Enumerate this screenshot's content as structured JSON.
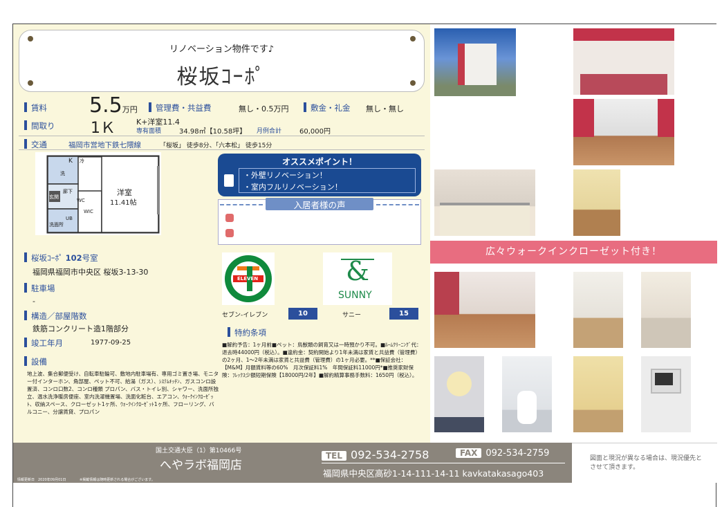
{
  "header": {
    "subtitle": "リノベーション物件です♪",
    "title": "桜坂ｺｰﾎﾟ"
  },
  "rent": {
    "label": "賃料",
    "amount": "5.5",
    "unit": "万円",
    "fee_label": "管理費・共益費",
    "fee_value": "無し・0.5万円",
    "deposit_label": "敷金・礼金",
    "deposit_value": "無し・無し"
  },
  "layout": {
    "label": "間取り",
    "value": "1Ｋ",
    "detail": "K+洋室11.4",
    "area_label": "専有面積",
    "area_value": "34.98㎡【10.58坪】",
    "monthly_label": "月例合計",
    "monthly_value": "60,000円"
  },
  "transport": {
    "label": "交通",
    "line": "福岡市営地下鉄七隈線",
    "stations": "「桜坂」 徒歩8分、「六本松」 徒歩15分"
  },
  "floorplan": {
    "room_name": "洋室",
    "room_size": "11.41帖",
    "k": "K",
    "ro": "冷",
    "wc": "WC",
    "ub": "UB",
    "genkan": "玄関",
    "rouka": "廊下",
    "sen": "洗",
    "senmen": "洗面所",
    "wic": "WIC"
  },
  "points": {
    "title": "オススメポイント！",
    "items": [
      "・外壁リノベーション！",
      "・室内フルリノベーション！"
    ]
  },
  "voice": {
    "title": "入居者様の声"
  },
  "property": {
    "name_prefix": "桜坂ｺｰﾎﾟ",
    "room": "102",
    "room_suffix": "号室",
    "address": "福岡県福岡市中央区 桜坂3-13-30",
    "parking_label": "駐車場",
    "parking_value": "-",
    "structure_label": "構造／部屋階数",
    "structure_value": "鉄筋コンクリート造1階部分",
    "built_label": "竣工年月",
    "built_value": "1977-09-25",
    "equip_label": "設備",
    "equip_value": "地上波、集合郵便受け、自転車駐輪可、敷地内駐車場有、専用ゴミ置き場、モニター付インターホン、角部屋、ペット不可、給湯（ガス）、ｼｽﾃﾑｷｯﾁﾝ、ガスコンロ設置済、コンロ口数2、コンロ種類 プロパン、バス・トイレ別、シャワー、洗面所独立、温水洗浄暖房便座、室内洗濯機置場、洗面化粧台、エアコン、ｳｫｰｸｲﾝｸﾛｰｾﾞｯﾄ、収納スペース、クローゼット1ヶ所、ｳｫｰｸｲﾝｸﾛｰｾﾞｯﾄ1ヶ所、フローリング、バルコニー、分譲賃貸、プロパン"
  },
  "shops": [
    {
      "logo_text": "ELEVEN",
      "name": "セブン-イレブン",
      "distance": "10"
    },
    {
      "logo_text": "SUNNY",
      "name": "サニー",
      "distance": "15"
    }
  ],
  "special": {
    "label": "特約条項",
    "text": "■解約予告：1ヶ月前■ペット：鳥獣類の飼育又は一時預かり不可。■ﾙｰﾑｸﾘｰﾆﾝｸﾞ代：退去時44000円（税込）。■違約金：契約開始より1年未満は家賃と共益費（管理費）の2ヶ月、1〜2年未満は家賃と共益費（管理費）の1ヶ月必要。**■保証会社：【M&M】月額賃料等の60%　月次保証料1%　年間保証料11000円*■推奨家財保険：ﾌﾚｯｸｽ少額短期保険【18000円/2年】■解約精算事務手数料：1650円（税込）。"
  },
  "banner": "広々ウォークインクローゼット付き！",
  "footer": {
    "license": "国土交通大臣（1）第10466号",
    "company": "へやラボ福岡店",
    "tel_label": "TEL",
    "tel": "092-534-2758",
    "fax_label": "FAX",
    "fax": "092-534-2759",
    "address": "福岡県中央区高砂1-14-111-14-11 kavkatakasago403",
    "update": "情報更新日　2020年09月01日",
    "disclaimer_small": "※掲載情報は随時更新される場合がございます。",
    "note": "図面と現況が異なる場合は、現況優先とさせて頂きます。"
  },
  "colors": {
    "accent": "#2b4f9c",
    "panel": "#faf7dc",
    "banner": "#e86d80",
    "footer": "#8b857c"
  }
}
